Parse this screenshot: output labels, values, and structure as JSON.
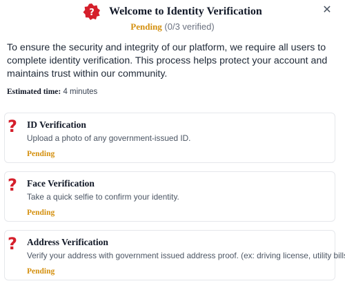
{
  "header": {
    "title": "Welcome to Identity Verification",
    "icon": "question-badge-icon",
    "close_icon": "close-icon",
    "close_glyph": "✕",
    "status": "Pending",
    "progress": " (0/3 verified)"
  },
  "intro": "To ensure the security and integrity of our platform, we require all users to complete identity verification. This process helps protect your account and maintains trust within our community.",
  "estimate": {
    "label": "Estimated time:",
    "value": " 4 minutes"
  },
  "steps": [
    {
      "icon": "question-mark-icon",
      "glyph": "?",
      "title": "ID Verification",
      "description": "Upload a photo of any government-issued ID.",
      "status": "Pending"
    },
    {
      "icon": "question-mark-icon",
      "glyph": "?",
      "title": "Face Verification",
      "description": "Take a quick selfie to confirm your identity.",
      "status": "Pending"
    },
    {
      "icon": "question-mark-icon",
      "glyph": "?",
      "title": "Address Verification",
      "description": "Verify your address with government issued address proof. (ex: driving license, utility bills)",
      "status": "Pending"
    }
  ],
  "colors": {
    "pending": "#d4900f",
    "icon_red": "#d51f2b"
  }
}
